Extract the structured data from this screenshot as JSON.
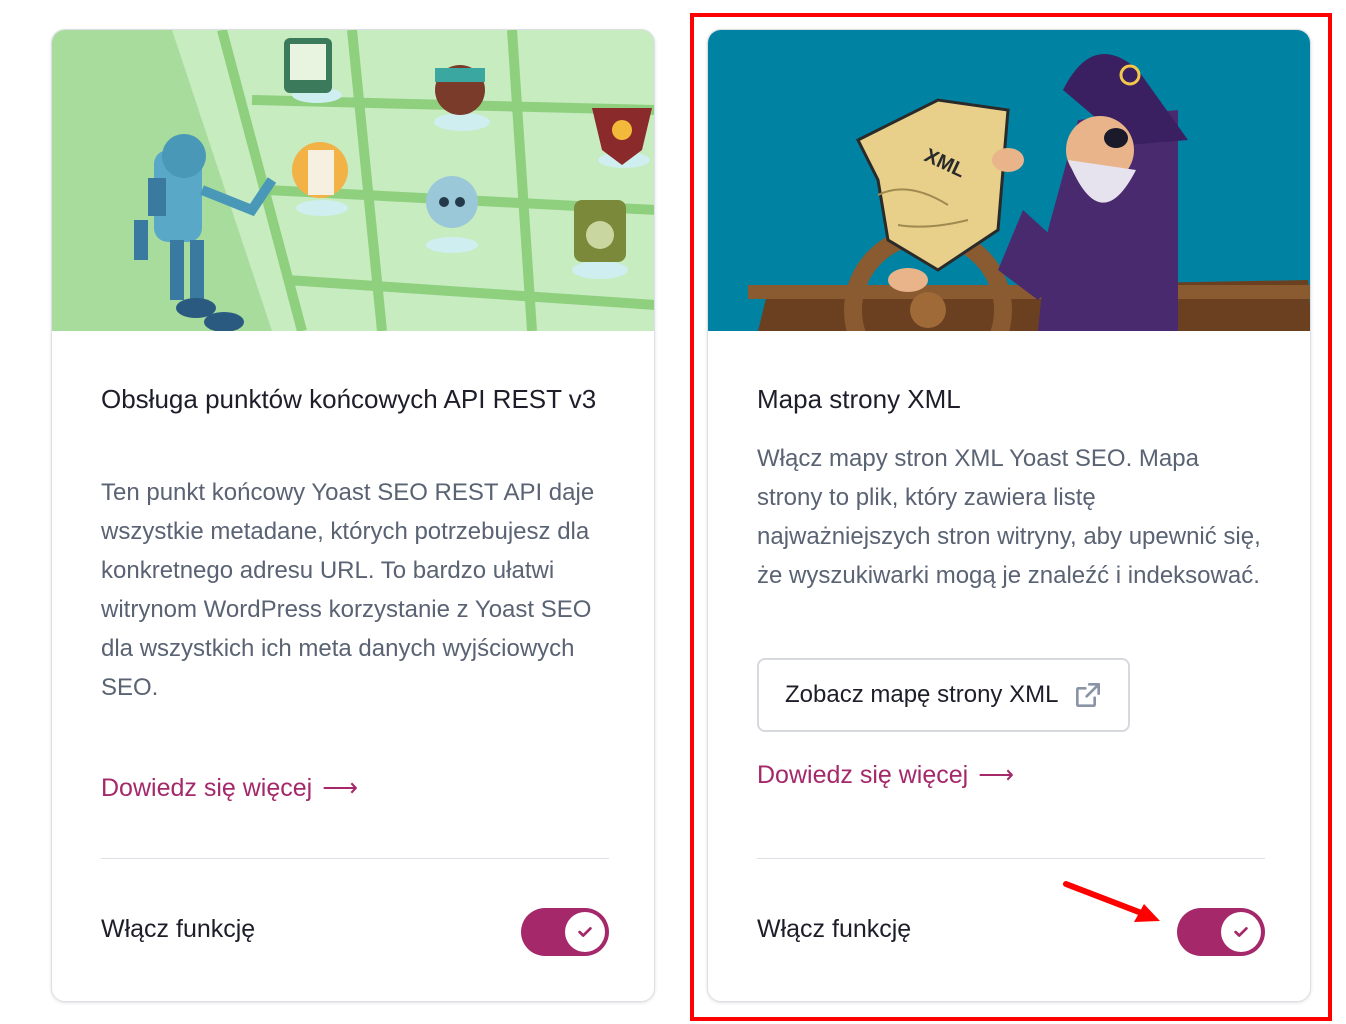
{
  "colors": {
    "accent": "#a4286a",
    "highlight": "#ff0000",
    "hero_green": "#a8dc9c",
    "hero_teal": "#0083a3"
  },
  "cards": [
    {
      "title": "Obsługa punktów końcowych API REST v3",
      "description": "Ten punkt końcowy Yoast SEO REST API daje wszystkie metadane, których potrzebujesz dla konkretnego adresu URL. To bardzo ułatwi witrynom WordPress korzystanie z Yoast SEO dla wszystkich ich meta danych wyjściowych SEO.",
      "learn_more": "Dowiedz się więcej",
      "learn_more_arrow": "⟶",
      "toggle_label": "Włącz funkcję",
      "enabled": true,
      "illustration": "robots-shelf-illustration"
    },
    {
      "title": "Mapa strony XML",
      "description": "Włącz mapy stron XML Yoast SEO. Mapa strony to plik, który zawiera listę najważniejszych stron witryny, aby upewnić się, że wyszukiwarki mogą je znaleźć i indeksować.",
      "button_label": "Zobacz mapę strony XML",
      "button_icon": "external-link-icon",
      "learn_more": "Dowiedz się więcej",
      "learn_more_arrow": "⟶",
      "toggle_label": "Włącz funkcję",
      "enabled": true,
      "illustration": "pirate-map-illustration",
      "map_text": "XML"
    }
  ]
}
